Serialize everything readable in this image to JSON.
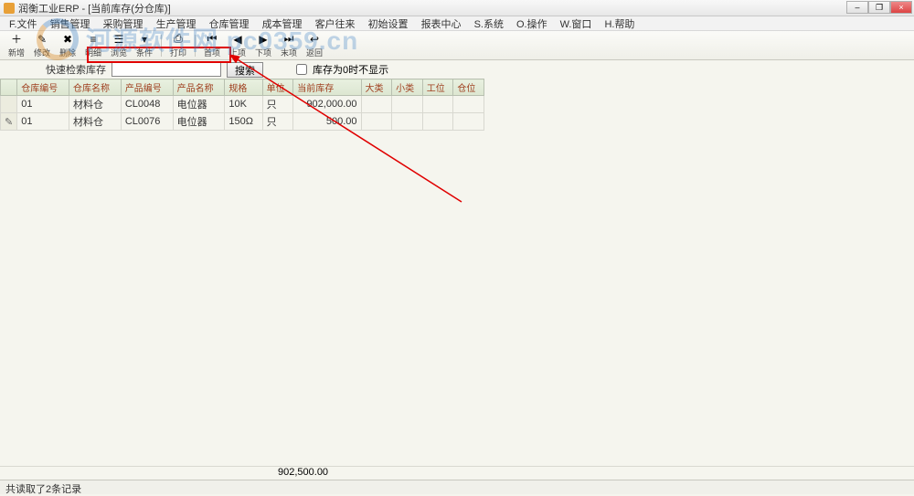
{
  "window": {
    "title": "润衡工业ERP - [当前库存(分仓库)]"
  },
  "menu": {
    "file": "F.文件",
    "sales": "销售管理",
    "purchase": "采购管理",
    "production": "生产管理",
    "warehouse": "仓库管理",
    "cost": "成本管理",
    "customer": "客户往来",
    "init": "初始设置",
    "report": "报表中心",
    "system": "S.系统",
    "operate": "O.操作",
    "window_menu": "W.窗口",
    "help": "H.帮助"
  },
  "toolbar": {
    "add": "新增",
    "modify": "修改",
    "delete": "删除",
    "detail": "明细",
    "browse": "浏览",
    "condition": "条件",
    "print": "打印",
    "first": "首项",
    "prev": "上项",
    "next": "下项",
    "last": "末项",
    "return": "返回"
  },
  "search": {
    "label": "快速检索库存",
    "placeholder": "",
    "value": "",
    "button": "搜索",
    "hide_zero": "库存为0时不显示"
  },
  "table": {
    "headers": {
      "wh_no": "仓库编号",
      "wh_name": "仓库名称",
      "prod_no": "产品编号",
      "prod_name": "产品名称",
      "spec": "规格",
      "unit": "单位",
      "stock": "当前库存",
      "cat1": "大类",
      "cat2": "小类",
      "station": "工位",
      "location": "仓位"
    },
    "rows": [
      {
        "wh_no": "01",
        "wh_name": "材料仓",
        "prod_no": "CL0048",
        "prod_name": "电位器",
        "spec": "10K",
        "unit": "只",
        "stock": "902,000.00"
      },
      {
        "wh_no": "01",
        "wh_name": "材料仓",
        "prod_no": "CL0076",
        "prod_name": "电位器",
        "spec": "150Ω",
        "unit": "只",
        "stock": "500.00"
      }
    ],
    "total_stock": "902,500.00"
  },
  "status": {
    "text": "共读取了2条记录"
  },
  "watermark": {
    "text": "河源软件网 pc0359.cn"
  }
}
